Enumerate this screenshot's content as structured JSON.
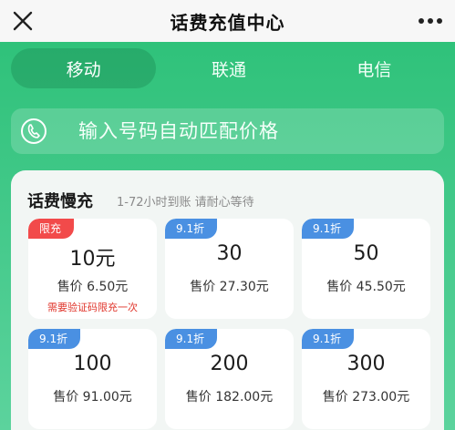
{
  "header": {
    "title": "话费充值中心"
  },
  "carrier_tabs": [
    {
      "label": "移动",
      "active": true
    },
    {
      "label": "联通",
      "active": false
    },
    {
      "label": "电信",
      "active": false
    }
  ],
  "phone_input": {
    "placeholder": "输入号码自动匹配价格"
  },
  "section": {
    "title": "话费慢充",
    "subtitle": "1-72小时到账 请耐心等待"
  },
  "cards": [
    {
      "badge": "限充",
      "badge_color": "red",
      "amount": "10元",
      "price": "售价 6.50元",
      "note": "需要验证码限充一次"
    },
    {
      "badge": "9.1折",
      "badge_color": "blue",
      "amount": "30",
      "price": "售价 27.30元",
      "note": ""
    },
    {
      "badge": "9.1折",
      "badge_color": "blue",
      "amount": "50",
      "price": "售价 45.50元",
      "note": ""
    },
    {
      "badge": "9.1折",
      "badge_color": "blue",
      "amount": "100",
      "price": "售价 91.00元",
      "note": ""
    },
    {
      "badge": "9.1折",
      "badge_color": "blue",
      "amount": "200",
      "price": "售价 182.00元",
      "note": ""
    },
    {
      "badge": "9.1折",
      "badge_color": "blue",
      "amount": "300",
      "price": "售价 273.00元",
      "note": ""
    }
  ],
  "colors": {
    "accent": "#2fc27a",
    "badge_blue": "#4a90e2",
    "badge_red": "#f24a4a",
    "note_red": "#e0352b"
  }
}
